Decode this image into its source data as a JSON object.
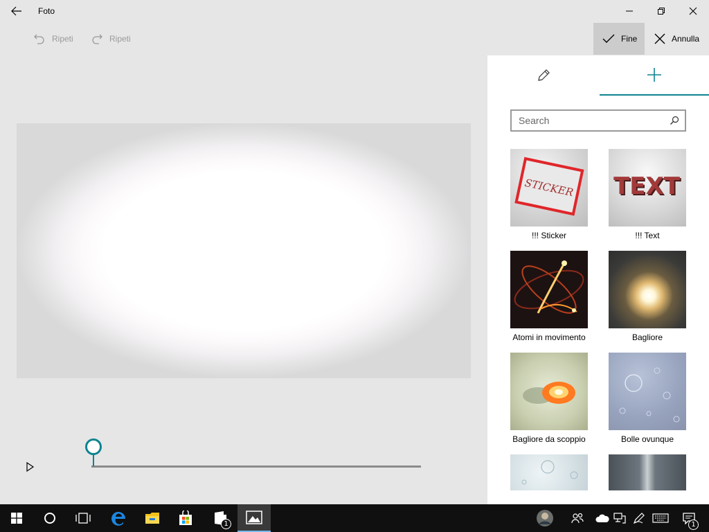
{
  "window": {
    "title": "Foto"
  },
  "commands": {
    "undo_label": "Ripeti",
    "redo_label": "Ripeti",
    "done_label": "Fine",
    "cancel_label": "Annulla"
  },
  "panel": {
    "tabs": [
      {
        "name": "pencil-icon",
        "selected": false
      },
      {
        "name": "plus-icon",
        "selected": true
      }
    ],
    "search": {
      "placeholder": "Search",
      "value": ""
    },
    "effects": [
      {
        "label": "!!! Sticker",
        "thumb_text": "STICKER"
      },
      {
        "label": "!!! Text",
        "thumb_text": "TEXT"
      },
      {
        "label": "Atomi in movimento"
      },
      {
        "label": "Bagliore"
      },
      {
        "label": "Bagliore da scoppio"
      },
      {
        "label": "Bolle ovunque"
      },
      {
        "label": ""
      },
      {
        "label": ""
      }
    ]
  },
  "timeline": {
    "position": 0.0
  },
  "taskbar": {
    "items": [
      "start-icon",
      "cortana-icon",
      "task-view-icon",
      "edge-icon",
      "file-explorer-icon",
      "store-icon",
      "app-icon",
      "photos-icon"
    ],
    "app_badge": "1",
    "notification_badge": "1"
  },
  "colors": {
    "accent": "#0e8390",
    "taskbar": "#101010",
    "sticker_red": "#e0262a"
  }
}
